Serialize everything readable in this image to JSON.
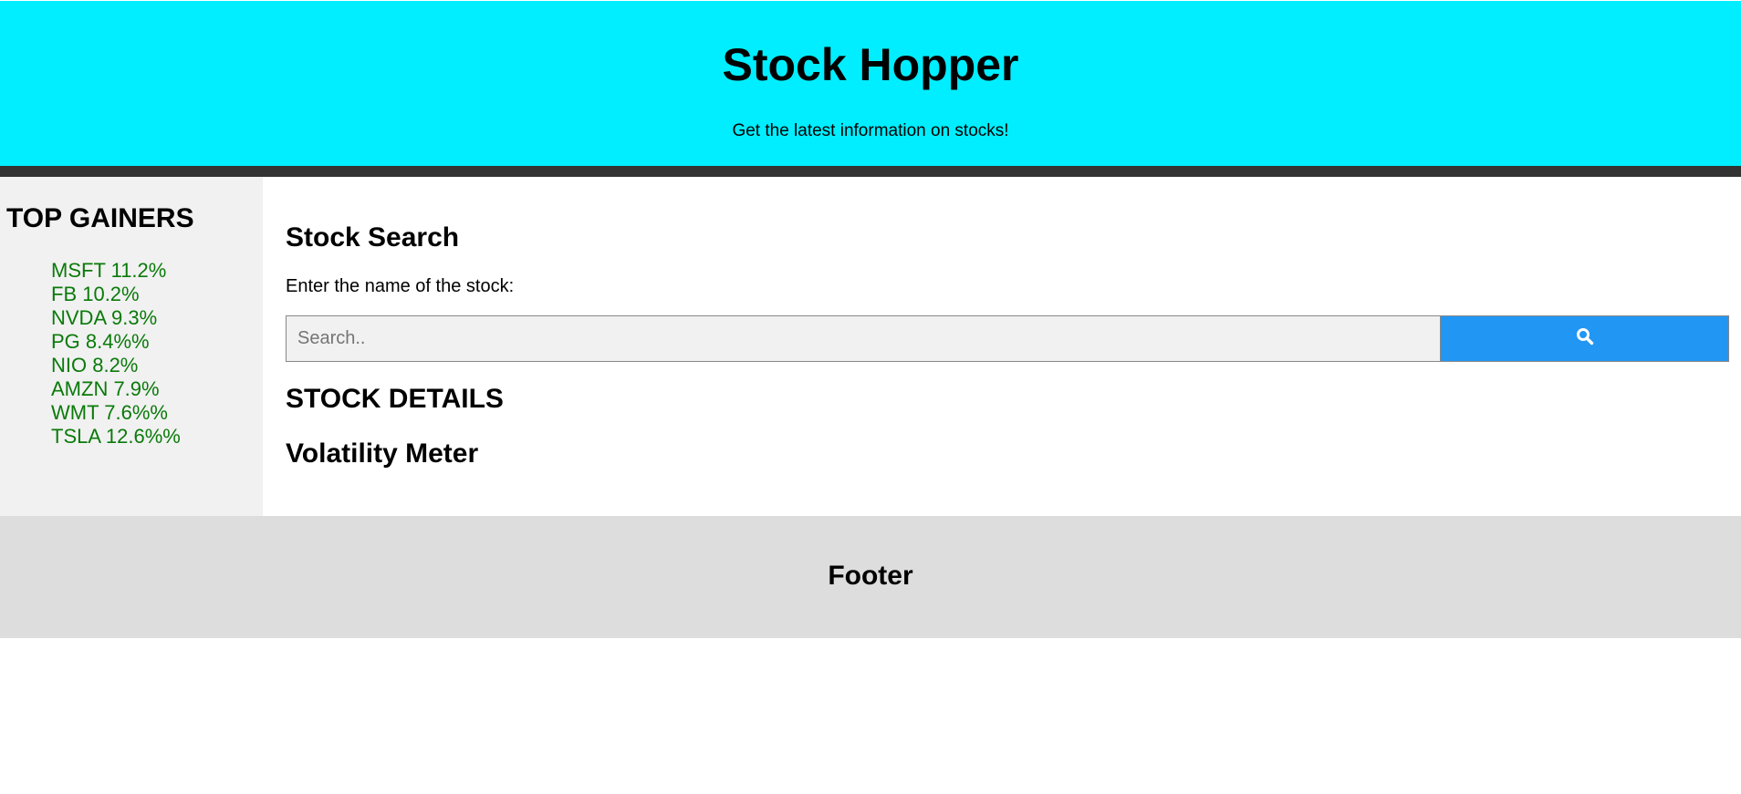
{
  "header": {
    "title": "Stock Hopper",
    "subtitle": "Get the latest information on stocks!"
  },
  "sidebar": {
    "title": "TOP GAINERS",
    "items": [
      {
        "label": "MSFT 11.2%"
      },
      {
        "label": "FB 10.2%"
      },
      {
        "label": "NVDA 9.3%"
      },
      {
        "label": "PG 8.4%%"
      },
      {
        "label": "NIO 8.2%"
      },
      {
        "label": "AMZN 7.9%"
      },
      {
        "label": "WMT 7.6%%"
      },
      {
        "label": "TSLA 12.6%%"
      }
    ]
  },
  "main": {
    "search_title": "Stock Search",
    "search_label": "Enter the name of the stock:",
    "search": {
      "placeholder": "Search..",
      "value": "",
      "button_icon": "search-icon"
    },
    "details_title": "STOCK DETAILS",
    "volatility_title": "Volatility Meter"
  },
  "footer": {
    "title": "Footer"
  },
  "colors": {
    "header_bg": "#00eeff",
    "divider": "#333333",
    "sidebar_bg": "#f1f1f1",
    "gainer_text": "#0a7a0a",
    "search_button": "#2196f3",
    "footer_bg": "#dddddd"
  }
}
